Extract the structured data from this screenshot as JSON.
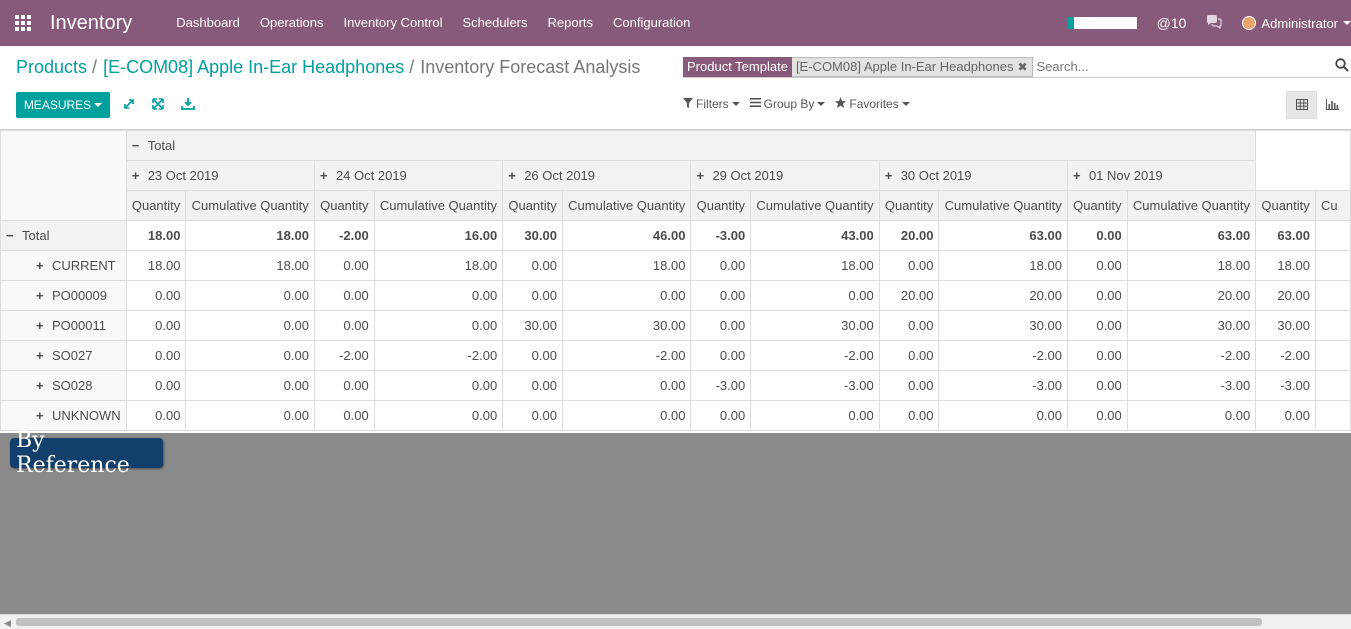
{
  "app": {
    "brand": "Inventory",
    "menu": [
      "Dashboard",
      "Operations",
      "Inventory Control",
      "Schedulers",
      "Reports",
      "Configuration"
    ],
    "mention_count": "@10",
    "user": "Administrator",
    "progress_fraction": 0.1
  },
  "breadcrumb": {
    "items": [
      "Products",
      "[E-COM08] Apple In-Ear Headphones"
    ],
    "separator": "/",
    "current": "Inventory Forecast Analysis"
  },
  "search": {
    "facet_label": "Product Template",
    "facet_value": "[E-COM08] Apple In-Ear Headphones",
    "facet_remove": "✖",
    "placeholder": "Search..."
  },
  "toolbar": {
    "measures_label": "MEASURES",
    "filters_label": "Filters",
    "groupby_label": "Group By",
    "favorites_label": "Favorites"
  },
  "pivot": {
    "top_header": "Total",
    "dates": [
      "23 Oct 2019",
      "24 Oct 2019",
      "26 Oct 2019",
      "29 Oct 2019",
      "30 Oct 2019",
      "01 Nov 2019"
    ],
    "measures": [
      "Quantity",
      "Cumulative Quantity"
    ],
    "grand_measures": [
      "Quantity",
      "Cu"
    ],
    "rows": [
      {
        "label": "Total",
        "expanded": true,
        "values": [
          "18.00",
          "18.00",
          "-2.00",
          "16.00",
          "30.00",
          "46.00",
          "-3.00",
          "43.00",
          "20.00",
          "63.00",
          "0.00",
          "63.00"
        ],
        "grand": "63.00"
      },
      {
        "label": "CURRENT",
        "values": [
          "18.00",
          "18.00",
          "0.00",
          "18.00",
          "0.00",
          "18.00",
          "0.00",
          "18.00",
          "0.00",
          "18.00",
          "0.00",
          "18.00"
        ],
        "grand": "18.00"
      },
      {
        "label": "PO00009",
        "values": [
          "0.00",
          "0.00",
          "0.00",
          "0.00",
          "0.00",
          "0.00",
          "0.00",
          "0.00",
          "20.00",
          "20.00",
          "0.00",
          "20.00"
        ],
        "grand": "20.00"
      },
      {
        "label": "PO00011",
        "values": [
          "0.00",
          "0.00",
          "0.00",
          "0.00",
          "30.00",
          "30.00",
          "0.00",
          "30.00",
          "0.00",
          "30.00",
          "0.00",
          "30.00"
        ],
        "grand": "30.00"
      },
      {
        "label": "SO027",
        "values": [
          "0.00",
          "0.00",
          "-2.00",
          "-2.00",
          "0.00",
          "-2.00",
          "0.00",
          "-2.00",
          "0.00",
          "-2.00",
          "0.00",
          "-2.00"
        ],
        "grand": "-2.00"
      },
      {
        "label": "SO028",
        "values": [
          "0.00",
          "0.00",
          "0.00",
          "0.00",
          "0.00",
          "0.00",
          "-3.00",
          "-3.00",
          "0.00",
          "-3.00",
          "0.00",
          "-3.00"
        ],
        "grand": "-3.00"
      },
      {
        "label": "UNKNOWN",
        "values": [
          "0.00",
          "0.00",
          "0.00",
          "0.00",
          "0.00",
          "0.00",
          "0.00",
          "0.00",
          "0.00",
          "0.00",
          "0.00",
          "0.00"
        ],
        "grand": "0.00"
      }
    ]
  },
  "tooltip": {
    "text": "By Reference"
  }
}
